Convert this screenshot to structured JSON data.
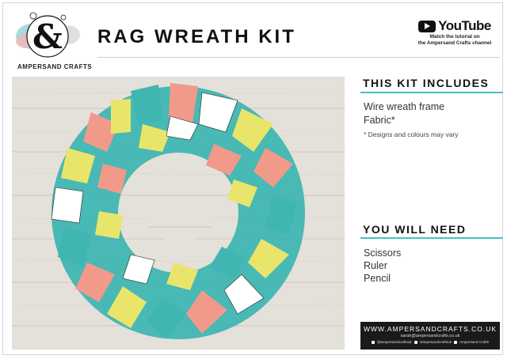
{
  "brand": {
    "logo_symbol": "&",
    "logo_name": "AMPERSAND CRAFTS"
  },
  "title": "RAG WREATH KIT",
  "youtube": {
    "logo_text": "YouTube",
    "line1": "Watch the tutorial on",
    "line2": "the Ampersand Crafts channel"
  },
  "kit_includes": {
    "heading": "THIS KIT INCLUDES",
    "items": [
      "Wire wreath frame",
      "Fabric*"
    ],
    "note": "* Designs and colours may vary"
  },
  "you_will_need": {
    "heading": "YOU WILL NEED",
    "items": [
      "Scissors",
      "Ruler",
      "Pencil"
    ]
  },
  "footer": {
    "website": "WWW.AMPERSANDCRAFTS.CO.UK",
    "email": "sarah@ampersandcrafts.co.uk",
    "social1": "@ampersandcraftsuk",
    "social2": "/ampersandcraftsuk",
    "social3": "Ampersand Crafts"
  },
  "colors": {
    "accent": "#44c1c7",
    "teal_fabric": "#3fb6b2",
    "coral_fabric": "#f19a8a",
    "yellow_fabric": "#e9e56b",
    "footer_bg": "#1a1a1a"
  }
}
